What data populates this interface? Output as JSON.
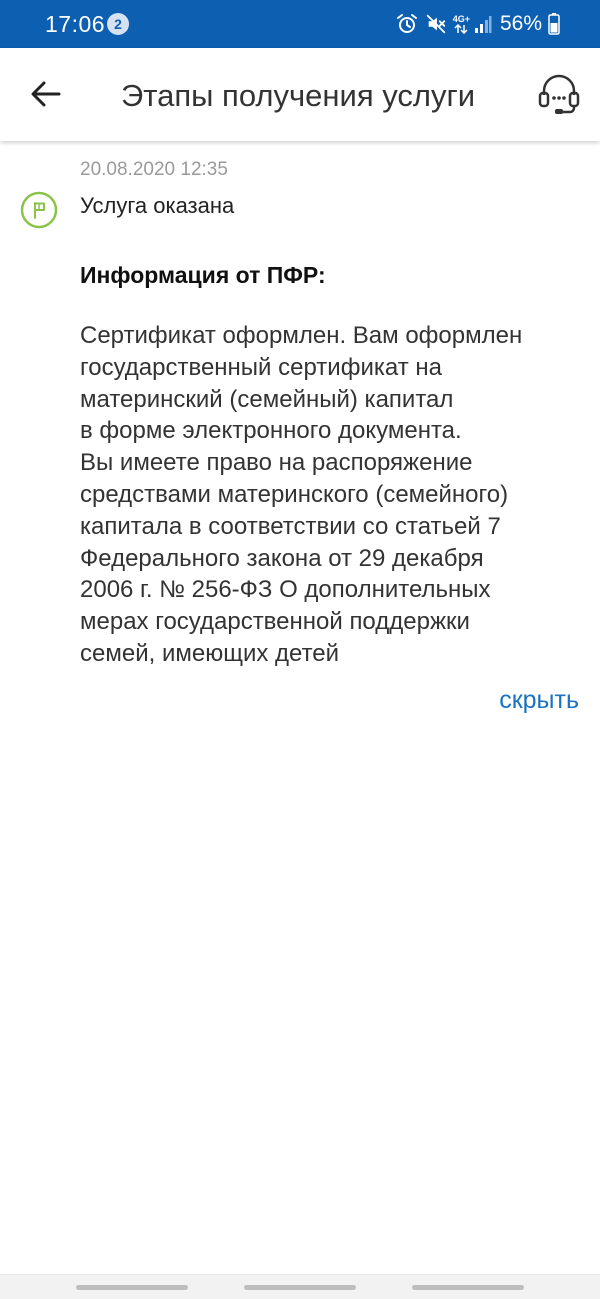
{
  "status_bar": {
    "time": "17:06",
    "notification_count": "2",
    "battery_percent": "56%",
    "network_label": "4G+",
    "background_color": "#0d5fb2",
    "icons": [
      "alarm-icon",
      "mute-icon",
      "network-4g-icon",
      "signal-icon",
      "battery-icon"
    ]
  },
  "app_bar": {
    "title": "Этапы получения услуги",
    "back_icon": "arrow-left-icon",
    "support_icon": "headset-icon"
  },
  "stage": {
    "date": "20.08.2020 12:35",
    "status": "Услуга оказана",
    "status_icon": "flag-icon",
    "status_color": "#8bc34a"
  },
  "info": {
    "heading": "Информация от ПФР:",
    "lines": [
      "Сертификат оформлен. Вам оформлен",
      "государственный сертификат на",
      "материнский (семейный) капитал",
      "в форме электронного документа.",
      "Вы имеете право на распоряжение",
      "средствами материнского (семейного)",
      "капитала в соответствии со статьей 7",
      "Федерального закона от 29 декабря",
      "2006 г. № 256-ФЗ О дополнительных",
      "мерах государственной поддержки",
      "семей, имеющих детей"
    ]
  },
  "hide_link": {
    "label": "скрыть",
    "color": "#1a73c1"
  }
}
